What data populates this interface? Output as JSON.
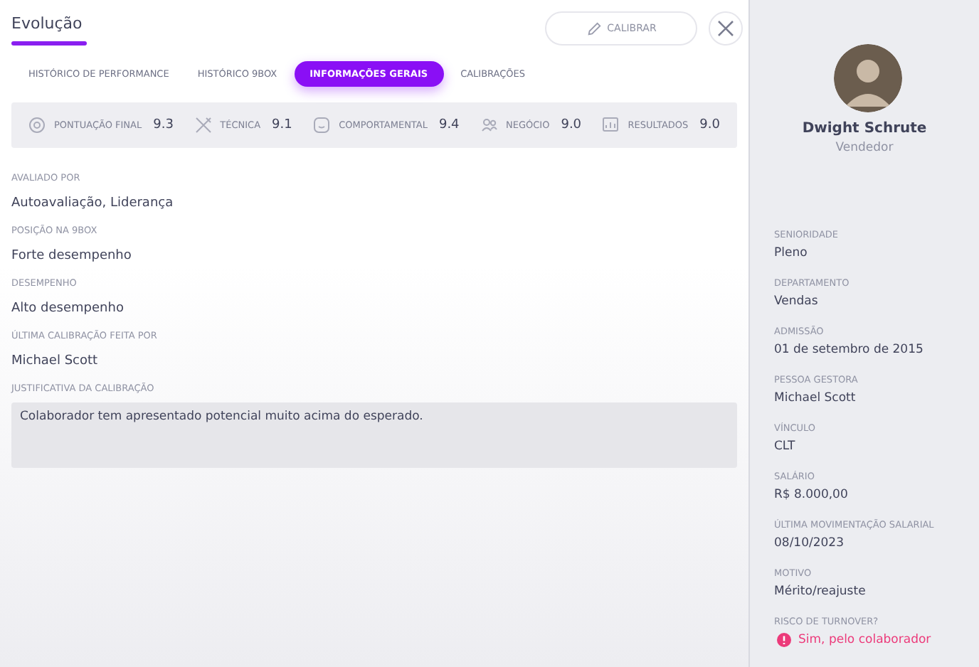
{
  "header": {
    "title": "Evolução",
    "calibrate_button": "CALIBRAR"
  },
  "tabs": [
    {
      "label": "HISTÓRICO DE PERFORMANCE",
      "selected": false
    },
    {
      "label": "HISTÓRICO 9BOX",
      "selected": false
    },
    {
      "label": "INFORMAÇÕES GERAIS",
      "selected": true
    },
    {
      "label": "CALIBRAÇÕES",
      "selected": false
    }
  ],
  "scores": [
    {
      "kind": "final",
      "label": "PONTUAÇÃO FINAL",
      "value": "9.3"
    },
    {
      "kind": "technical",
      "label": "TÉCNICA",
      "value": "9.1"
    },
    {
      "kind": "behavioral",
      "label": "COMPORTAMENTAL",
      "value": "9.4"
    },
    {
      "kind": "business",
      "label": "NEGÓCIO",
      "value": "9.0"
    },
    {
      "kind": "results",
      "label": "RESULTADOS",
      "value": "9.0"
    }
  ],
  "details": [
    {
      "label": "AVALIADO POR",
      "value": "Autoavaliação, Liderança"
    },
    {
      "label": "POSIÇÃO NA 9BOX",
      "value": "Forte desempenho"
    },
    {
      "label": "DESEMPENHO",
      "value": "Alto desempenho"
    },
    {
      "label": "ÚLTIMA CALIBRAÇÃO FEITA POR",
      "value": "Michael Scott"
    }
  ],
  "justification": {
    "label": "JUSTIFICATIVA DA CALIBRAÇÃO",
    "value": "Colaborador tem apresentado potencial muito acima do esperado."
  },
  "profile": {
    "name": "Dwight Schrute",
    "role": "Vendedor"
  },
  "profile_fields": [
    {
      "kind": "text",
      "label": "SENIORIDADE",
      "value": "Pleno"
    },
    {
      "kind": "text",
      "label": "DEPARTAMENTO",
      "value": "Vendas"
    },
    {
      "kind": "text",
      "label": "ADMISSÃO",
      "value": "01 de setembro de 2015"
    },
    {
      "kind": "text",
      "label": "PESSOA GESTORA",
      "value": "Michael Scott"
    },
    {
      "kind": "text",
      "label": "VÍNCULO",
      "value": "CLT"
    },
    {
      "kind": "text",
      "label": "SALÁRIO",
      "value": "R$ 8.000,00"
    },
    {
      "kind": "text",
      "label": "ÚLTIMA MOVIMENTAÇÃO SALARIAL",
      "value": "08/10/2023"
    },
    {
      "kind": "text",
      "label": "MOTIVO",
      "value": "Mérito/reajuste"
    },
    {
      "kind": "alert",
      "label": "RISCO DE TURNOVER?",
      "value": "Sim, pelo colaborador"
    }
  ]
}
